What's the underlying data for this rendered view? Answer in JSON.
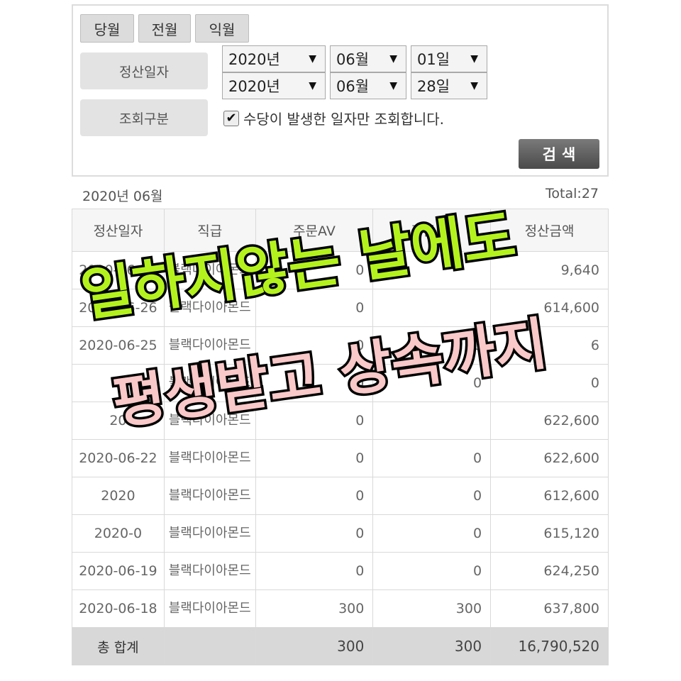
{
  "filter": {
    "month_buttons": [
      "당월",
      "전월",
      "익월"
    ],
    "settlement_date_label": "정산일자",
    "start": {
      "year": "2020년",
      "month": "06월",
      "day": "01일"
    },
    "end": {
      "year": "2020년",
      "month": "06월",
      "day": "28일"
    },
    "query_type_label": "조회구분",
    "checkbox_checked": true,
    "checkbox_mark": "✔",
    "checkbox_label": "수당이 발생한 일자만 조회합니다.",
    "search_button": "검색",
    "caret": "▼"
  },
  "summary": {
    "period": "2020년 06월",
    "total": "Total:27"
  },
  "table": {
    "headers": [
      "정산일자",
      "직급",
      "주문AV",
      "주문PV",
      "정산금액"
    ],
    "rows": [
      {
        "date": "2020-06-27",
        "rank": "블랙다이아몬드",
        "av": "0",
        "pv": "",
        "amount": "9,640"
      },
      {
        "date": "2020-06-26",
        "rank": "블랙다이아몬드",
        "av": "0",
        "pv": "",
        "amount": "614,600"
      },
      {
        "date": "2020-06-25",
        "rank": "블랙다이아몬드",
        "av": "0",
        "pv": "0",
        "amount": "6"
      },
      {
        "date": "2",
        "rank": "블랙다이아몬드",
        "av": "0",
        "pv": "0",
        "amount": "0"
      },
      {
        "date": "20",
        "rank": "블랙다이아몬드",
        "av": "0",
        "pv": "",
        "amount": "622,600"
      },
      {
        "date": "2020-06-22",
        "rank": "블랙다이아몬드",
        "av": "0",
        "pv": "0",
        "amount": "622,600"
      },
      {
        "date": "2020",
        "rank": "블랙다이아몬드",
        "av": "0",
        "pv": "0",
        "amount": "612,600"
      },
      {
        "date": "2020-0",
        "rank": "블랙다이아몬드",
        "av": "0",
        "pv": "0",
        "amount": "615,120"
      },
      {
        "date": "2020-06-19",
        "rank": "블랙다이아몬드",
        "av": "0",
        "pv": "0",
        "amount": "624,250"
      },
      {
        "date": "2020-06-18",
        "rank": "블랙다이아몬드",
        "av": "300",
        "pv": "300",
        "amount": "637,800"
      }
    ],
    "total": {
      "label": "총 합계",
      "av": "300",
      "pv": "300",
      "amount": "16,790,520"
    }
  },
  "overlay": {
    "line1": "일하지않는 날에도",
    "line2": "평생받고 상속까지",
    "line1_color": "#b4f21e",
    "line2_color": "#f9c8c8"
  }
}
